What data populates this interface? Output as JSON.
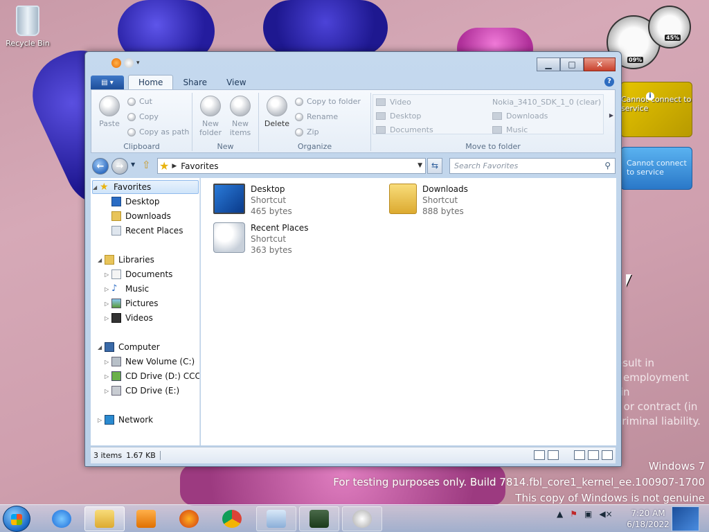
{
  "desktop": {
    "recycle_bin_label": "Recycle Bin",
    "meter_cpu": "09%",
    "meter_mem": "45%",
    "gadget_weather_text": "Cannot connect to service",
    "gadget_feed_text": "Cannot connect to service",
    "watermark_lines": [
      "esult in",
      "f employment (in",
      "t or contract (in",
      "criminal liability."
    ],
    "os_name": "Windows 7",
    "build_line": "For testing purposes only. Build 7814.fbl_core1_kernel_ee.100907-1700",
    "genuine_line": "This copy of Windows is not genuine"
  },
  "window": {
    "tabs": [
      "Home",
      "Share",
      "View"
    ],
    "active_tab": "Home",
    "ribbon": {
      "clipboard": {
        "paste": "Paste",
        "cut": "Cut",
        "copy": "Copy",
        "copy_as_path": "Copy as path",
        "label": "Clipboard"
      },
      "new": {
        "new_folder": "New folder",
        "new_items": "New items",
        "label": "New"
      },
      "organize": {
        "delete": "Delete",
        "copy_to_folder": "Copy to folder",
        "rename": "Rename",
        "zip": "Zip",
        "label": "Organize"
      },
      "move_to": {
        "items": [
          "Video",
          "Nokia_3410_SDK_1_0 (clear)",
          "Desktop",
          "Downloads",
          "Documents",
          "Music"
        ],
        "label": "Move to folder"
      }
    },
    "address": {
      "crumb": "Favorites",
      "search_placeholder": "Search Favorites"
    },
    "nav": {
      "favorites": "Favorites",
      "fav_items": [
        "Desktop",
        "Downloads",
        "Recent Places"
      ],
      "libraries": "Libraries",
      "lib_items": [
        "Documents",
        "Music",
        "Pictures",
        "Videos"
      ],
      "computer": "Computer",
      "drives": [
        "New Volume (C:)",
        "CD Drive (D:) CCCOI",
        "CD Drive (E:)"
      ],
      "network": "Network"
    },
    "files": [
      {
        "name": "Desktop",
        "type": "Shortcut",
        "size": "465 bytes"
      },
      {
        "name": "Downloads",
        "type": "Shortcut",
        "size": "888 bytes"
      },
      {
        "name": "Recent Places",
        "type": "Shortcut",
        "size": "363 bytes"
      }
    ],
    "status": {
      "count": "3 items",
      "size": "1.67 KB"
    }
  },
  "taskbar": {
    "time": "7:20 AM",
    "date": "6/18/2022"
  }
}
